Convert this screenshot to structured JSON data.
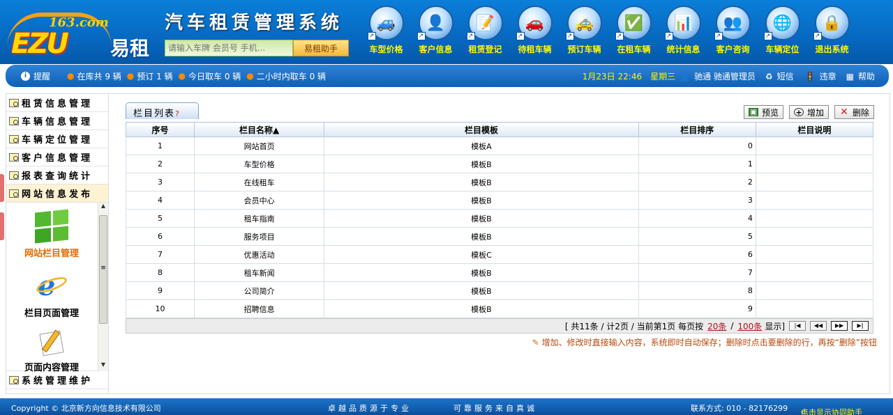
{
  "logo": {
    "small": "163.com",
    "brand": "EZU",
    "name": "易租"
  },
  "system_title": "汽车租赁管理系统",
  "search": {
    "placeholder": "请输入车牌 会员号 手机...",
    "button": "易租助手"
  },
  "nav": [
    {
      "label": "车型价格",
      "icon": "car-price-icon",
      "glyph": "🚙"
    },
    {
      "label": "客户信息",
      "icon": "customer-info-icon",
      "glyph": "👤"
    },
    {
      "label": "租赁登记",
      "icon": "rental-register-icon",
      "glyph": "📝"
    },
    {
      "label": "待租车辆",
      "icon": "available-car-icon",
      "glyph": "🚗"
    },
    {
      "label": "预订车辆",
      "icon": "reserve-car-icon",
      "glyph": "🚕"
    },
    {
      "label": "在租车辆",
      "icon": "rented-car-icon",
      "glyph": "✅"
    },
    {
      "label": "统计信息",
      "icon": "statistics-icon",
      "glyph": "📊"
    },
    {
      "label": "客户咨询",
      "icon": "consult-icon",
      "glyph": "👥"
    },
    {
      "label": "车辆定位",
      "icon": "locate-car-icon",
      "glyph": "🌐"
    },
    {
      "label": "退出系统",
      "icon": "exit-icon",
      "glyph": "🔒"
    }
  ],
  "infobar": {
    "remind": "提醒",
    "in_stock": "在库共 9 辆",
    "reserved": "预订 1 辆",
    "today_pick": "今日取车 0 辆",
    "two_hours": "二小时内取车 0 辆",
    "date": "1月23日 22:46",
    "weekday": "星期三",
    "user": "驰通 驰通管理员",
    "sms": "短信",
    "violation": "违章",
    "help": "帮助"
  },
  "left_menu": {
    "top": [
      "租赁信息管理",
      "车辆信息管理",
      "车辆定位管理",
      "客户信息管理",
      "报表查询统计",
      "网站信息发布"
    ],
    "sub": [
      {
        "label": "网站栏目管理",
        "icon": "windows-logo-icon"
      },
      {
        "label": "栏目页面管理",
        "icon": "ie-logo-icon"
      },
      {
        "label": "页面内容管理",
        "icon": "pencil-document-icon"
      }
    ],
    "bottom": "系统管理维护"
  },
  "tab": {
    "label": "栏目列表",
    "help": "?"
  },
  "toolbar": {
    "preview": "预览",
    "add": "增加",
    "delete": "删除"
  },
  "table": {
    "headers": [
      "序号",
      "栏目名称▲",
      "栏目模板",
      "栏目排序",
      "栏目说明"
    ],
    "rows": [
      [
        "1",
        "网站首页",
        "模板A",
        "0",
        ""
      ],
      [
        "2",
        "车型价格",
        "模板B",
        "1",
        ""
      ],
      [
        "3",
        "在线租车",
        "模板B",
        "2",
        ""
      ],
      [
        "4",
        "会员中心",
        "模板B",
        "3",
        ""
      ],
      [
        "5",
        "租车指南",
        "模板B",
        "4",
        ""
      ],
      [
        "6",
        "服务项目",
        "模板B",
        "5",
        ""
      ],
      [
        "7",
        "优惠活动",
        "模板C",
        "6",
        ""
      ],
      [
        "8",
        "租车新闻",
        "模板B",
        "7",
        ""
      ],
      [
        "9",
        "公司简介",
        "模板B",
        "8",
        ""
      ],
      [
        "10",
        "招聘信息",
        "模板B",
        "9",
        ""
      ]
    ]
  },
  "pager": {
    "summary": "[ 共11条 / 计2页 / 当前第1页 每页按",
    "opt20": "20条",
    "sep": "/",
    "opt100": "100条",
    "show": "显示]"
  },
  "hint": "增加、修改时直接输入内容，系统即时自动保存；删除时点击要删除的行，再按“删除”按钮",
  "footer": {
    "copyright": "Copyright © 北京新方向信息技术有限公司",
    "slogan1": "卓越品质源于专业",
    "slogan2": "可靠服务来自真诚",
    "contact": "联系方式: 010 - 82176299",
    "assist": "点击显示协同助手"
  }
}
